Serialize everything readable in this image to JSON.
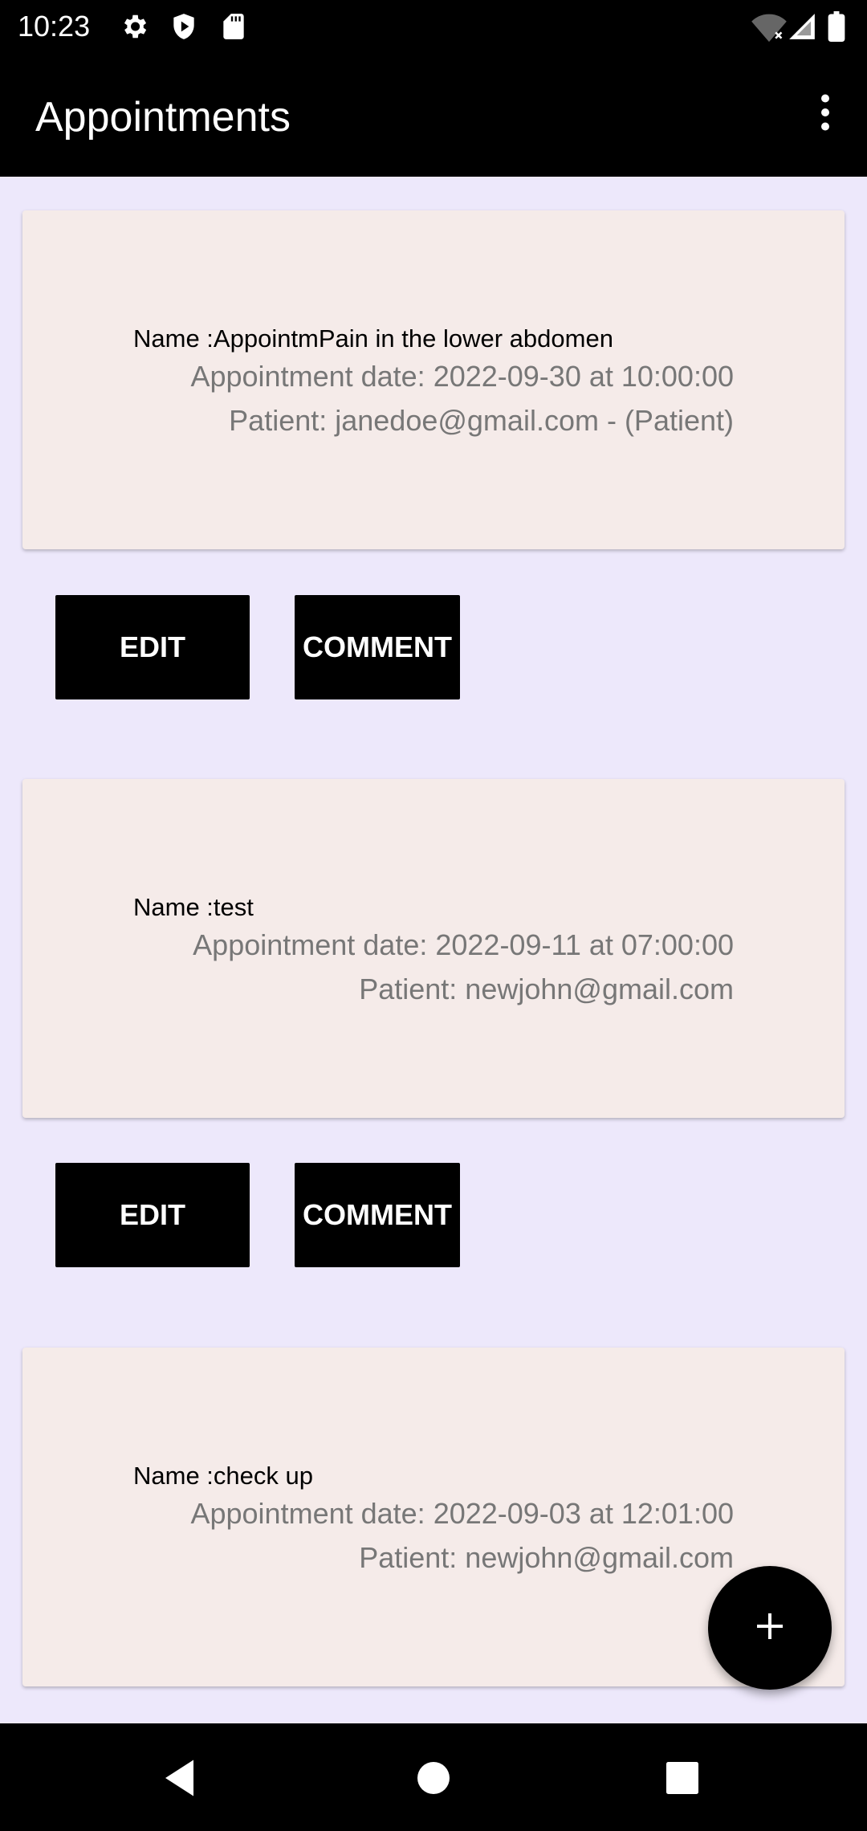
{
  "status_bar": {
    "time": "10:23",
    "icons_left": [
      "gear-icon",
      "shield-icon",
      "sd-card-icon"
    ],
    "icons_right": [
      "wifi-off-icon",
      "signal-icon",
      "battery-icon"
    ]
  },
  "app_bar": {
    "title": "Appointments",
    "menu_icon": "more-vert-icon"
  },
  "appointments": [
    {
      "name": "Name :AppointmPain in the lower abdomen",
      "date": "Appointment date: 2022-09-30 at 10:00:00",
      "patient": "Patient: janedoe@gmail.com - (Patient)",
      "edit_label": "EDIT",
      "comment_label": "COMMENT"
    },
    {
      "name": "Name :test",
      "date": "Appointment date: 2022-09-11 at 07:00:00",
      "patient": "Patient: newjohn@gmail.com",
      "edit_label": "EDIT",
      "comment_label": "COMMENT"
    },
    {
      "name": "Name :check up",
      "date": "Appointment date: 2022-09-03 at 12:01:00",
      "patient": "Patient: newjohn@gmail.com"
    }
  ],
  "fab": {
    "icon": "add-icon"
  },
  "nav_bar": {
    "icons": [
      "back-icon",
      "home-icon",
      "recents-icon"
    ]
  },
  "colors": {
    "background": "#ede8fb",
    "card": "#f5ebe9",
    "bar": "#000000",
    "secondary_text": "#777777"
  }
}
